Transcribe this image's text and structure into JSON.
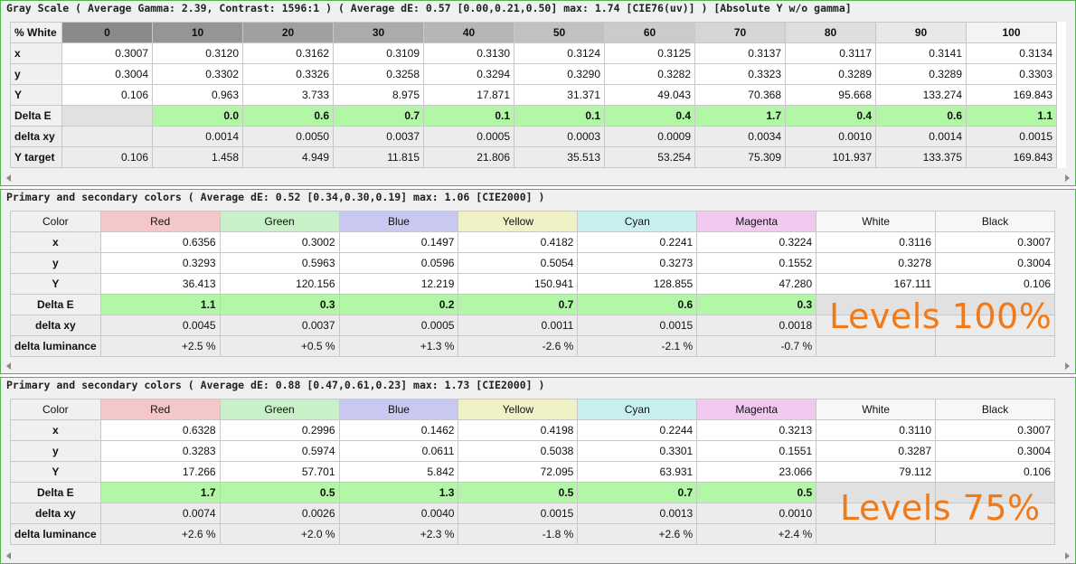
{
  "gray_panel": {
    "title": "Gray Scale ( Average Gamma: 2.39, Contrast: 1596:1 ) ( Average dE: 0.57 [0.00,0.21,0.50] max: 1.74 [CIE76(uv)] ) [Absolute Y w/o gamma]",
    "corner": "% White",
    "columns": [
      {
        "label": "0",
        "color": "#8a8a8a"
      },
      {
        "label": "10",
        "color": "#959595"
      },
      {
        "label": "20",
        "color": "#a0a0a0"
      },
      {
        "label": "30",
        "color": "#ababab"
      },
      {
        "label": "40",
        "color": "#b6b6b6"
      },
      {
        "label": "50",
        "color": "#c1c1c1"
      },
      {
        "label": "60",
        "color": "#cbcbcb"
      },
      {
        "label": "70",
        "color": "#d5d5d5"
      },
      {
        "label": "80",
        "color": "#dedede"
      },
      {
        "label": "90",
        "color": "#e8e8e8"
      },
      {
        "label": "100",
        "color": "#f3f3f3"
      }
    ],
    "rows": [
      {
        "label": "x",
        "values": [
          "0.3007",
          "0.3120",
          "0.3162",
          "0.3109",
          "0.3130",
          "0.3124",
          "0.3125",
          "0.3137",
          "0.3117",
          "0.3141",
          "0.3134"
        ]
      },
      {
        "label": "y",
        "values": [
          "0.3004",
          "0.3302",
          "0.3326",
          "0.3258",
          "0.3294",
          "0.3290",
          "0.3282",
          "0.3323",
          "0.3289",
          "0.3289",
          "0.3303"
        ]
      },
      {
        "label": "Y",
        "values": [
          "0.106",
          "0.963",
          "3.733",
          "8.975",
          "17.871",
          "31.371",
          "49.043",
          "70.368",
          "95.668",
          "133.274",
          "169.843"
        ]
      },
      {
        "label": "Delta E",
        "kind": "de",
        "values": [
          "",
          "0.0",
          "0.6",
          "0.7",
          "0.1",
          "0.1",
          "0.4",
          "1.7",
          "0.4",
          "0.6",
          "1.1"
        ]
      },
      {
        "label": "delta xy",
        "kind": "shade",
        "values": [
          "",
          "0.0014",
          "0.0050",
          "0.0037",
          "0.0005",
          "0.0003",
          "0.0009",
          "0.0034",
          "0.0010",
          "0.0014",
          "0.0015"
        ]
      },
      {
        "label": "Y target",
        "kind": "shade",
        "values": [
          "0.106",
          "1.458",
          "4.949",
          "11.815",
          "21.806",
          "35.513",
          "53.254",
          "75.309",
          "101.937",
          "133.375",
          "169.843"
        ]
      }
    ]
  },
  "color_panels": [
    {
      "title": "Primary and secondary colors ( Average dE: 0.52 [0.34,0.30,0.19] max: 1.06 [CIE2000] )",
      "overlay": "Levels 100%",
      "corner": "Color",
      "columns": [
        {
          "label": "Red",
          "color": "#f4c8c8"
        },
        {
          "label": "Green",
          "color": "#c9f0c9"
        },
        {
          "label": "Blue",
          "color": "#c8c8f0"
        },
        {
          "label": "Yellow",
          "color": "#f1f1c8"
        },
        {
          "label": "Cyan",
          "color": "#c8f0f0"
        },
        {
          "label": "Magenta",
          "color": "#f0c8f0"
        },
        {
          "label": "White",
          "color": "#f7f7f7"
        },
        {
          "label": "Black",
          "color": "#f7f7f7"
        }
      ],
      "rows": [
        {
          "label": "x",
          "values": [
            "0.6356",
            "0.3002",
            "0.1497",
            "0.4182",
            "0.2241",
            "0.3224",
            "0.3116",
            "0.3007"
          ]
        },
        {
          "label": "y",
          "values": [
            "0.3293",
            "0.5963",
            "0.0596",
            "0.5054",
            "0.3273",
            "0.1552",
            "0.3278",
            "0.3004"
          ]
        },
        {
          "label": "Y",
          "values": [
            "36.413",
            "120.156",
            "12.219",
            "150.941",
            "128.855",
            "47.280",
            "167.111",
            "0.106"
          ]
        },
        {
          "label": "Delta E",
          "kind": "de",
          "values": [
            "1.1",
            "0.3",
            "0.2",
            "0.7",
            "0.6",
            "0.3",
            "",
            ""
          ]
        },
        {
          "label": "delta xy",
          "kind": "shade",
          "values": [
            "0.0045",
            "0.0037",
            "0.0005",
            "0.0011",
            "0.0015",
            "0.0018",
            "",
            ""
          ]
        },
        {
          "label": "delta luminance",
          "kind": "shade",
          "values": [
            "+2.5 %",
            "+0.5 %",
            "+1.3 %",
            "-2.6 %",
            "-2.1 %",
            "-0.7 %",
            "",
            ""
          ]
        }
      ]
    },
    {
      "title": "Primary and secondary colors ( Average dE: 0.88 [0.47,0.61,0.23] max: 1.73 [CIE2000] )",
      "overlay": "Levels 75%",
      "corner": "Color",
      "columns": [
        {
          "label": "Red",
          "color": "#f4c8c8"
        },
        {
          "label": "Green",
          "color": "#c9f0c9"
        },
        {
          "label": "Blue",
          "color": "#c8c8f0"
        },
        {
          "label": "Yellow",
          "color": "#f1f1c8"
        },
        {
          "label": "Cyan",
          "color": "#c8f0f0"
        },
        {
          "label": "Magenta",
          "color": "#f0c8f0"
        },
        {
          "label": "White",
          "color": "#f7f7f7"
        },
        {
          "label": "Black",
          "color": "#f7f7f7"
        }
      ],
      "rows": [
        {
          "label": "x",
          "values": [
            "0.6328",
            "0.2996",
            "0.1462",
            "0.4198",
            "0.2244",
            "0.3213",
            "0.3110",
            "0.3007"
          ]
        },
        {
          "label": "y",
          "values": [
            "0.3283",
            "0.5974",
            "0.0611",
            "0.5038",
            "0.3301",
            "0.1551",
            "0.3287",
            "0.3004"
          ]
        },
        {
          "label": "Y",
          "values": [
            "17.266",
            "57.701",
            "5.842",
            "72.095",
            "63.931",
            "23.066",
            "79.112",
            "0.106"
          ]
        },
        {
          "label": "Delta E",
          "kind": "de",
          "values": [
            "1.7",
            "0.5",
            "1.3",
            "0.5",
            "0.7",
            "0.5",
            "",
            ""
          ]
        },
        {
          "label": "delta xy",
          "kind": "shade",
          "values": [
            "0.0074",
            "0.0026",
            "0.0040",
            "0.0015",
            "0.0013",
            "0.0010",
            "",
            ""
          ]
        },
        {
          "label": "delta luminance",
          "kind": "shade",
          "values": [
            "+2.6 %",
            "+2.0 %",
            "+2.3 %",
            "-1.8 %",
            "+2.6 %",
            "+2.4 %",
            "",
            ""
          ]
        }
      ]
    }
  ],
  "colors": {
    "delta_e_bg": "#b1f7a6",
    "panel_border": "#4cb84c",
    "overlay_text": "#f07a1a"
  }
}
